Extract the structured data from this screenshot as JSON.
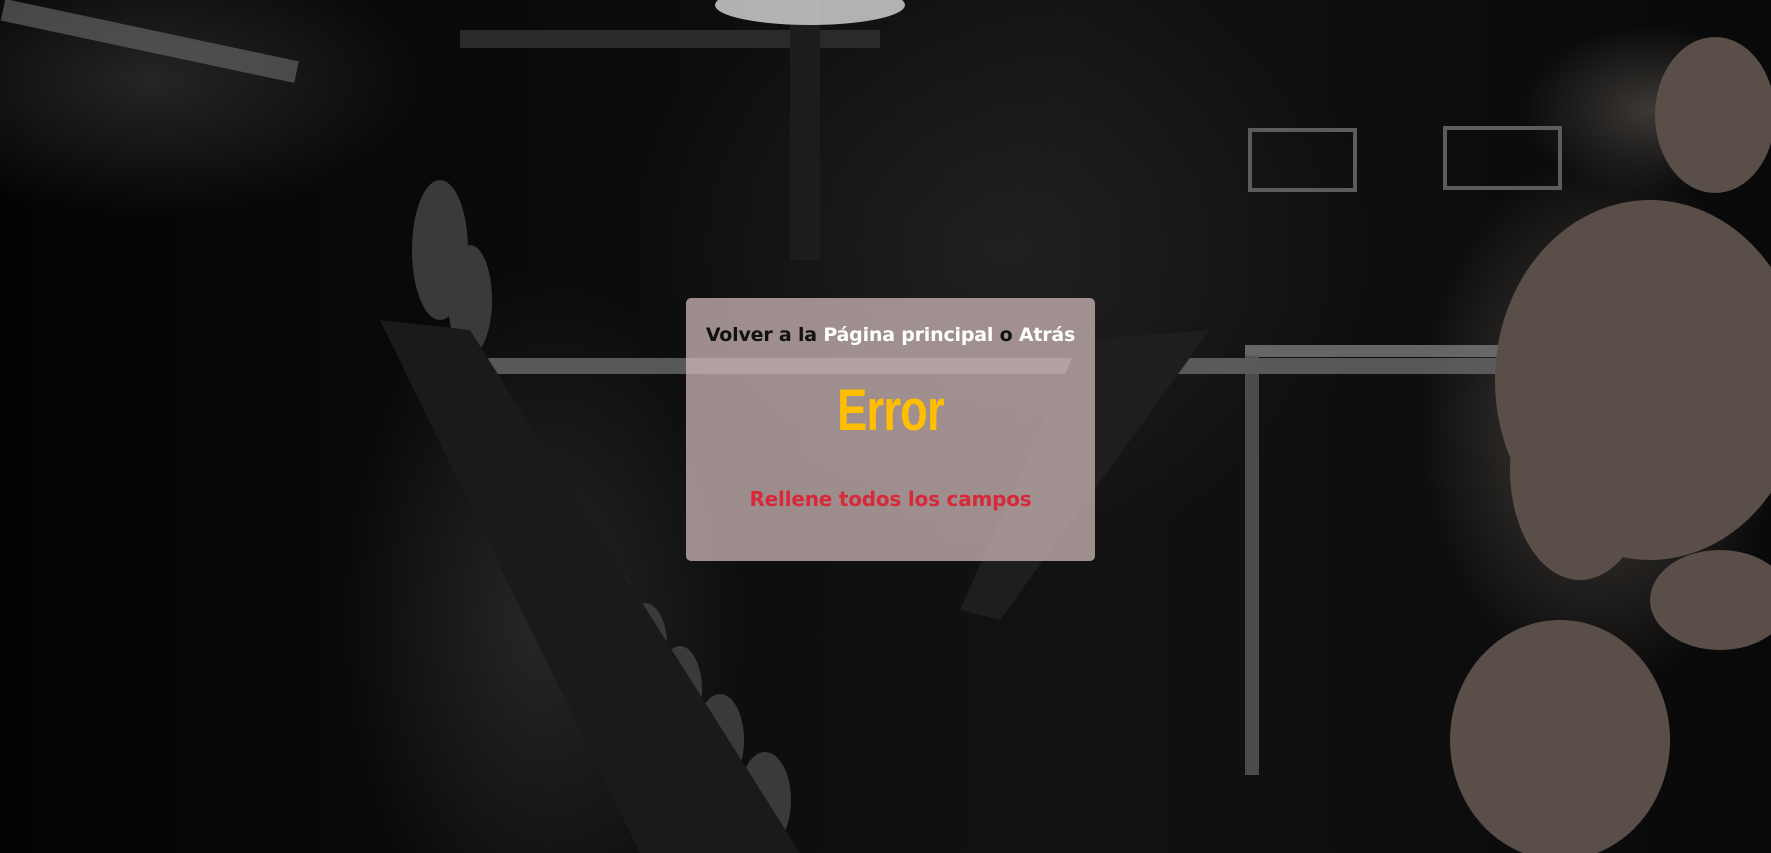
{
  "nav": {
    "prefix": "Volver a la ",
    "home_link": "Página principal",
    "separator": " o ",
    "back_link": "Atrás"
  },
  "title": "Error",
  "message": "Rellene todos los campos",
  "colors": {
    "title": "#ffbe00",
    "message": "#d8293a",
    "link": "#ffffff",
    "nav_text": "#111111",
    "card_background": "rgba(214,190,190,0.72)"
  }
}
